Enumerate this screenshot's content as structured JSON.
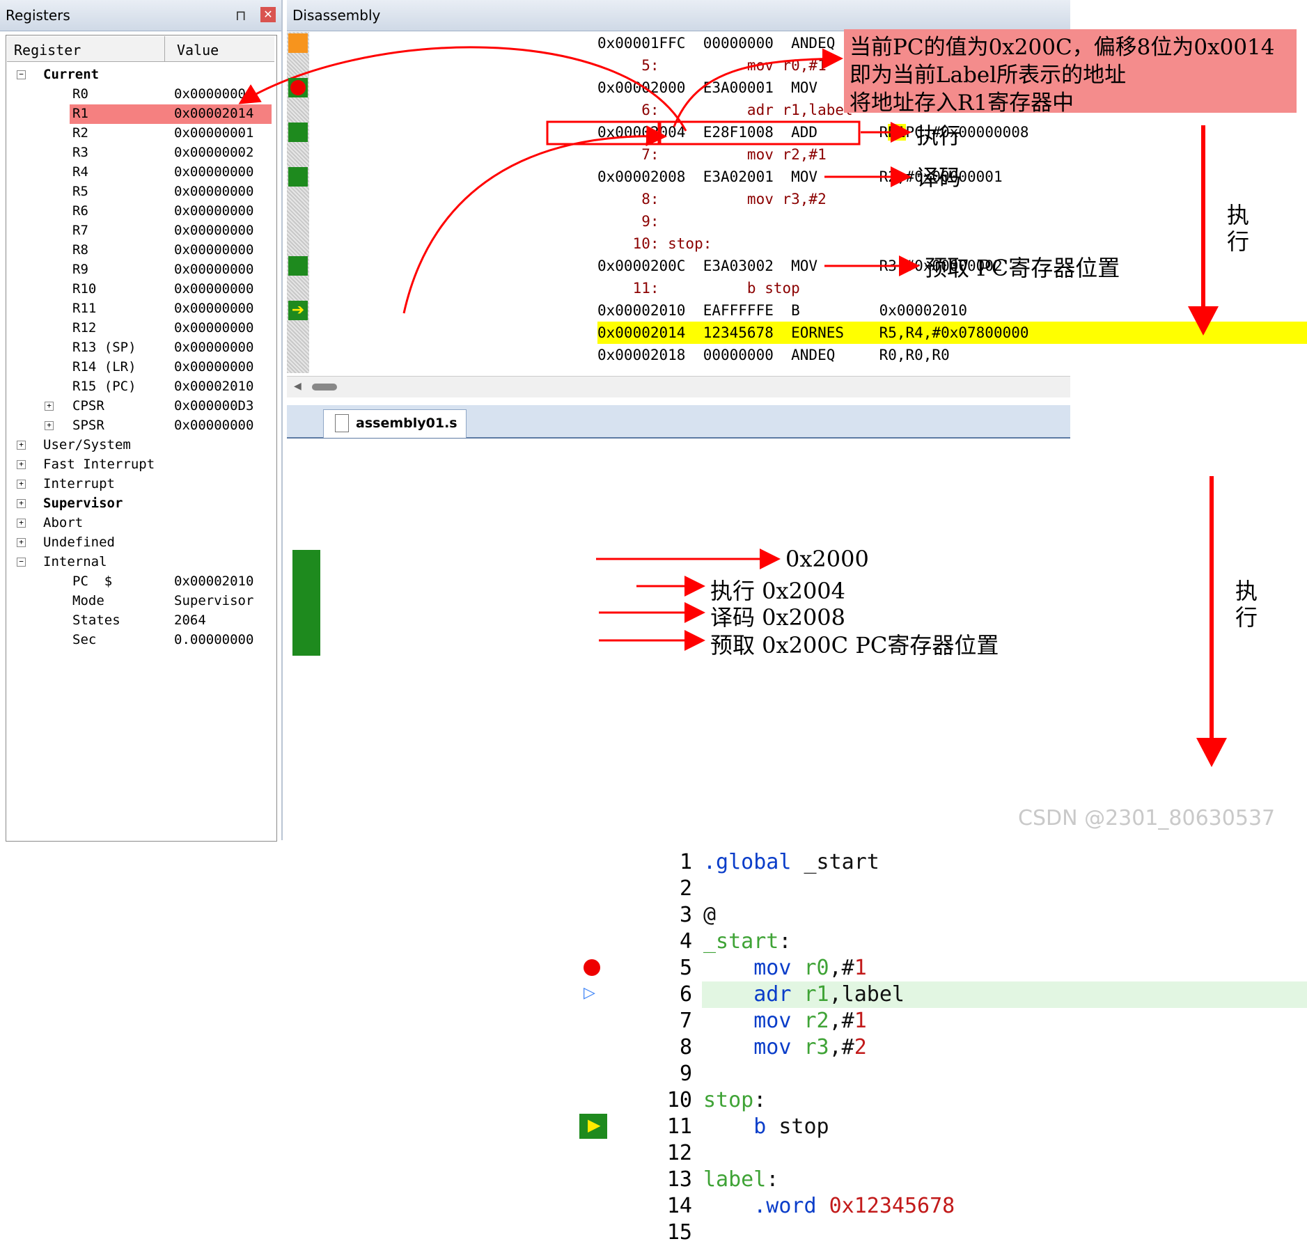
{
  "registers": {
    "title": "Registers",
    "pin_icon": "pin-icon",
    "close_icon": "close-icon",
    "col_register": "Register",
    "col_value": "Value",
    "current_label": "Current",
    "rows": [
      {
        "name": "R0",
        "value": "0x00000000"
      },
      {
        "name": "R1",
        "value": "0x00002014"
      },
      {
        "name": "R2",
        "value": "0x00000001"
      },
      {
        "name": "R3",
        "value": "0x00000002"
      },
      {
        "name": "R4",
        "value": "0x00000000"
      },
      {
        "name": "R5",
        "value": "0x00000000"
      },
      {
        "name": "R6",
        "value": "0x00000000"
      },
      {
        "name": "R7",
        "value": "0x00000000"
      },
      {
        "name": "R8",
        "value": "0x00000000"
      },
      {
        "name": "R9",
        "value": "0x00000000"
      },
      {
        "name": "R10",
        "value": "0x00000000"
      },
      {
        "name": "R11",
        "value": "0x00000000"
      },
      {
        "name": "R12",
        "value": "0x00000000"
      },
      {
        "name": "R13 (SP)",
        "value": "0x00000000"
      },
      {
        "name": "R14 (LR)",
        "value": "0x00000000"
      },
      {
        "name": "R15 (PC)",
        "value": "0x00002010"
      },
      {
        "name": "CPSR",
        "value": "0x000000D3"
      },
      {
        "name": "SPSR",
        "value": "0x00000000"
      }
    ],
    "groups": [
      "User/System",
      "Fast Interrupt",
      "Interrupt",
      "Supervisor",
      "Abort",
      "Undefined",
      "Internal"
    ],
    "internal": [
      {
        "name": "PC  $",
        "value": "0x00002010"
      },
      {
        "name": "Mode",
        "value": "Supervisor"
      },
      {
        "name": "States",
        "value": "2064"
      },
      {
        "name": "Sec",
        "value": "0.00000000"
      }
    ],
    "highlight_color": "#f58080"
  },
  "disassembly": {
    "title": "Disassembly",
    "lines": [
      {
        "text": "0x00001FFC  00000000  ANDEQ     R0,R0,R0",
        "kind": "code"
      },
      {
        "text": "     5:          mov r0,#1",
        "kind": "src"
      },
      {
        "text": "0x00002000  E3A00001  MOV       R0,#0x00000001",
        "kind": "code"
      },
      {
        "text": "     6:          adr r1,label",
        "kind": "src"
      },
      {
        "text": "0x00002004  E28F1008  ADD       R1,PC,#0x00000008",
        "kind": "code"
      },
      {
        "text": "     7:          mov r2,#1",
        "kind": "src"
      },
      {
        "text": "0x00002008  E3A02001  MOV       R2,#0x00000001",
        "kind": "code"
      },
      {
        "text": "     8:          mov r3,#2",
        "kind": "src"
      },
      {
        "text": "     9:",
        "kind": "src"
      },
      {
        "text": "    10: stop:",
        "kind": "src"
      },
      {
        "text": "0x0000200C  E3A03002  MOV       R3,#0x00000002",
        "kind": "code"
      },
      {
        "text": "    11:          b stop",
        "kind": "src"
      },
      {
        "text": "0x00002010  EAFFFFFE  B         0x00002010",
        "kind": "code"
      },
      {
        "text": "0x00002014  12345678  EORNES    R5,R4,#0x07800000",
        "kind": "code"
      },
      {
        "text": "0x00002018  00000000  ANDEQ     R0,R0,R0",
        "kind": "code"
      }
    ],
    "highlight_color": "#ffff00"
  },
  "editor": {
    "tab": "assembly01.s",
    "lines": [
      {
        "n": "1",
        "segs": [
          {
            "t": ".global",
            "c": "kw"
          },
          {
            "t": " _start",
            "c": "plain"
          }
        ]
      },
      {
        "n": "2",
        "segs": []
      },
      {
        "n": "3",
        "segs": [
          {
            "t": "@",
            "c": "plain"
          }
        ]
      },
      {
        "n": "4",
        "segs": [
          {
            "t": "_start",
            "c": "lbl"
          },
          {
            "t": ":",
            "c": "plain"
          }
        ]
      },
      {
        "n": "5",
        "segs": [
          {
            "t": "    mov ",
            "c": "kw"
          },
          {
            "t": "r0",
            "c": "lbl"
          },
          {
            "t": ",#",
            "c": "plain"
          },
          {
            "t": "1",
            "c": "num"
          }
        ]
      },
      {
        "n": "6",
        "segs": [
          {
            "t": "    adr ",
            "c": "kw"
          },
          {
            "t": "r1",
            "c": "lbl"
          },
          {
            "t": ",label",
            "c": "plain"
          }
        ]
      },
      {
        "n": "7",
        "segs": [
          {
            "t": "    mov ",
            "c": "kw"
          },
          {
            "t": "r2",
            "c": "lbl"
          },
          {
            "t": ",#",
            "c": "plain"
          },
          {
            "t": "1",
            "c": "num"
          }
        ]
      },
      {
        "n": "8",
        "segs": [
          {
            "t": "    mov ",
            "c": "kw"
          },
          {
            "t": "r3",
            "c": "lbl"
          },
          {
            "t": ",#",
            "c": "plain"
          },
          {
            "t": "2",
            "c": "num"
          }
        ]
      },
      {
        "n": "9",
        "segs": []
      },
      {
        "n": "10",
        "segs": [
          {
            "t": "stop",
            "c": "lbl"
          },
          {
            "t": ":",
            "c": "plain"
          }
        ]
      },
      {
        "n": "11",
        "segs": [
          {
            "t": "    b ",
            "c": "kw"
          },
          {
            "t": "stop",
            "c": "plain"
          }
        ]
      },
      {
        "n": "12",
        "segs": []
      },
      {
        "n": "13",
        "segs": [
          {
            "t": "label",
            "c": "lbl"
          },
          {
            "t": ":",
            "c": "plain"
          }
        ]
      },
      {
        "n": "14",
        "segs": [
          {
            "t": "    .word ",
            "c": "kw"
          },
          {
            "t": "0x12345678",
            "c": "num"
          }
        ]
      },
      {
        "n": "15",
        "segs": []
      }
    ],
    "current_line_color": "#e2f6e2"
  },
  "annotations": {
    "note_lines": [
      "当前PC的值为0x200C，偏移8位为0x0014",
      "即为当前Label所表示的地址",
      "将地址存入R1寄存器中"
    ],
    "dis_exec": "执行",
    "dis_decode": "译码",
    "dis_fetch": "预取   PC寄存器位置",
    "side_exec_top": "执\n行",
    "side_exec_bottom": "执\n行",
    "ed_l5": "0x2000",
    "ed_l6": "执行   0x2004",
    "ed_l7": "译码   0x2008",
    "ed_l8": "预取   0x200C   PC寄存器位置",
    "watermark": "CSDN @2301_80630537",
    "arrow_color": "#ff0000"
  }
}
